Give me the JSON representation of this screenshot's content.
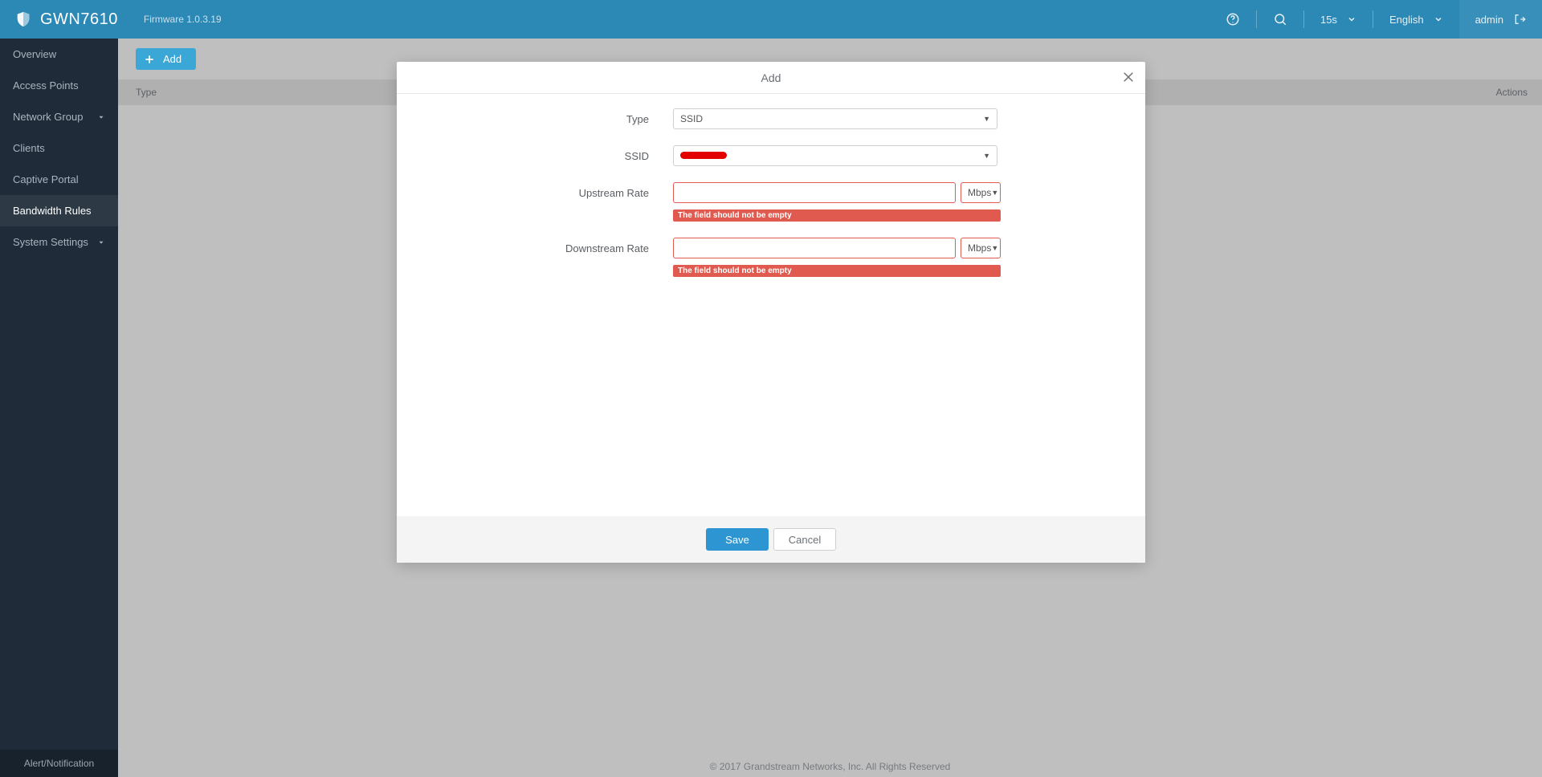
{
  "header": {
    "product_name": "GWN7610",
    "firmware_label": "Firmware 1.0.3.19",
    "refresh_interval": "15s",
    "language": "English",
    "user": "admin"
  },
  "sidebar": {
    "items": [
      {
        "label": "Overview",
        "expandable": false
      },
      {
        "label": "Access Points",
        "expandable": false
      },
      {
        "label": "Network Group",
        "expandable": true
      },
      {
        "label": "Clients",
        "expandable": false
      },
      {
        "label": "Captive Portal",
        "expandable": false
      },
      {
        "label": "Bandwidth Rules",
        "expandable": false
      },
      {
        "label": "System Settings",
        "expandable": true
      }
    ],
    "footer": "Alert/Notification"
  },
  "content": {
    "add_button_label": "Add",
    "table": {
      "col_type": "Type",
      "col_actions": "Actions"
    }
  },
  "modal": {
    "title": "Add",
    "labels": {
      "type": "Type",
      "ssid": "SSID",
      "upstream": "Upstream Rate",
      "downstream": "Downstream Rate"
    },
    "values": {
      "type_selected": "SSID",
      "ssid_selected_redacted": true,
      "upstream_value": "",
      "upstream_unit": "Mbps",
      "downstream_value": "",
      "downstream_unit": "Mbps"
    },
    "errors": {
      "empty_field": "The field should not be empty"
    },
    "buttons": {
      "save": "Save",
      "cancel": "Cancel"
    }
  },
  "footer": {
    "copyright": "© 2017 Grandstream Networks, Inc. All Rights Reserved"
  }
}
